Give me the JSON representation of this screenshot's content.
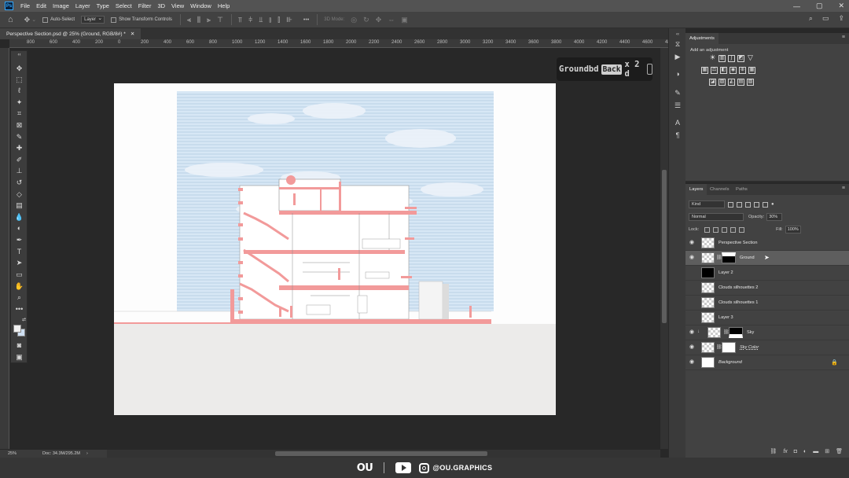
{
  "menubar": {
    "logo": "Ps",
    "items": [
      "File",
      "Edit",
      "Image",
      "Layer",
      "Type",
      "Select",
      "Filter",
      "3D",
      "View",
      "Window",
      "Help"
    ],
    "window_controls": [
      "—",
      "▢",
      "✕"
    ]
  },
  "options_bar": {
    "auto_select_label": "Auto-Select",
    "auto_select_target": "Layer",
    "show_transform_label": "Show Transform Controls",
    "more_label": "•••",
    "mode_3d_label": "3D Mode:"
  },
  "document": {
    "tab_title": "Perspective Section.psd @ 25% (Ground, RGB/8#) *",
    "close_glyph": "✕"
  },
  "ruler": {
    "h_ticks": [
      "800",
      "600",
      "400",
      "200",
      "0",
      "200",
      "400",
      "600",
      "800",
      "1000",
      "1200",
      "1400",
      "1600",
      "1800",
      "2000",
      "2200",
      "2400",
      "2600",
      "2800",
      "3000",
      "3200",
      "3400",
      "3600",
      "3800",
      "4000",
      "4200",
      "4400",
      "4600",
      "4800"
    ]
  },
  "tools": [
    "move-tool",
    "marquee-tool",
    "lasso-tool",
    "magic-wand-tool",
    "crop-tool",
    "frame-tool",
    "eyedropper-tool",
    "healing-tool",
    "brush-tool",
    "clone-stamp-tool",
    "history-brush-tool",
    "eraser-tool",
    "gradient-tool",
    "blur-tool",
    "dodge-tool",
    "pen-tool",
    "type-tool",
    "path-selection-tool",
    "rectangle-tool",
    "hand-tool",
    "zoom-tool",
    "more-tools"
  ],
  "colors": {
    "foreground": "#f2f2f2",
    "background": "#cfe0f3",
    "canvas_pink": "#f2a4a4",
    "sky_blue": "#d7e7f5"
  },
  "shortcut_hud": {
    "text1": "Groundbd",
    "key": "Back",
    "text2": "x 2 d"
  },
  "status": {
    "zoom": "25%",
    "doc": "Doc: 34.3M/295.2M",
    "arrow": "›"
  },
  "adjustments_panel": {
    "tab": "Adjustments",
    "hint": "Add an adjustment"
  },
  "layers_panel": {
    "tabs": [
      "Layers",
      "Channels",
      "Paths"
    ],
    "filter_kind": "Kind",
    "blend_mode": "Normal",
    "opacity_label": "Opacity:",
    "opacity_value": "30%",
    "lock_label": "Lock:",
    "fill_label": "Fill:",
    "fill_value": "100%",
    "layers": [
      {
        "name": "Perspective Section",
        "visible": true,
        "selected": false
      },
      {
        "name": "Ground",
        "visible": true,
        "selected": true
      },
      {
        "name": "Layer 2",
        "visible": false,
        "selected": false
      },
      {
        "name": "Clouds silhouettes 2",
        "visible": false,
        "selected": false
      },
      {
        "name": "Clouds silhouettes 1",
        "visible": false,
        "selected": false
      },
      {
        "name": "Layer 3",
        "visible": false,
        "selected": false
      },
      {
        "name": "Sky",
        "visible": true,
        "selected": false
      },
      {
        "name": "Sky Color",
        "visible": true,
        "selected": false
      },
      {
        "name": "Background",
        "visible": true,
        "selected": false
      }
    ],
    "footer_icons": [
      "link-icon",
      "fx-icon",
      "mask-icon",
      "adjustment-icon",
      "group-icon",
      "new-layer-icon",
      "delete-icon"
    ]
  },
  "branding": {
    "logo": "OU",
    "handle": "@OU.GRAPHICS"
  }
}
